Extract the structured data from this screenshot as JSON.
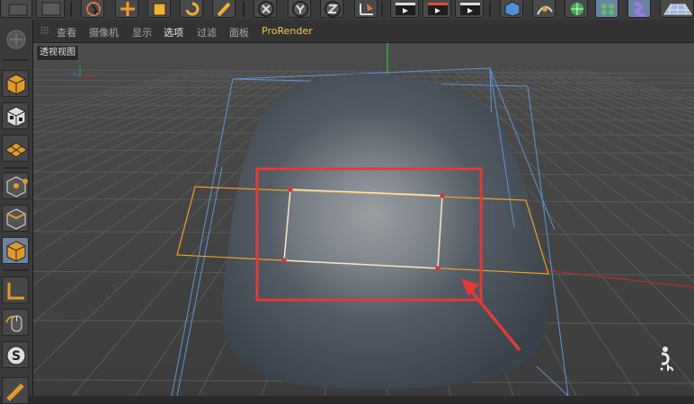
{
  "viewport_menu": {
    "items": [
      "查看",
      "摄像机",
      "显示",
      "选项",
      "过滤",
      "面板",
      "ProRender"
    ],
    "selected": "选项"
  },
  "viewport": {
    "label": "透视视图"
  },
  "colors": {
    "background": "#2b2b2b",
    "toolbar": "#3a3a3a",
    "viewport_sky": "#4b4b4b",
    "grid_line": "#5a5a5a",
    "object_body": "#4b535c",
    "bbox_line": "#5b95d8",
    "polygon_outline": "#f0a020",
    "selection_edge": "#f5e6c8",
    "selection_point": "#e03040",
    "annotation_red": "#e23a3a",
    "menu_text": "#a9a9a9",
    "prorender_text": "#f2c94c",
    "x_axis": "#c03030"
  },
  "toolbar_icons": [
    "render-region-icon",
    "select-icon",
    "move-icon",
    "scale-icon",
    "rotate-icon",
    "brush-icon",
    "x-axis-lock-icon",
    "y-axis-lock-icon",
    "z-axis-lock-icon",
    "world-coordinate-icon",
    "render-view-icon",
    "render-picture-viewer-icon",
    "render-settings-icon",
    "cube-object-icon",
    "pen-spline-icon",
    "subdivision-icon",
    "array-icon",
    "deformer-icon",
    "floor-icon"
  ],
  "palette_icons": [
    "make-editable-icon",
    "model-mode-icon",
    "texture-mode-icon",
    "workplane-icon",
    "points-mode-icon",
    "edges-mode-icon",
    "polygons-mode-icon",
    "axis-mode-icon",
    "tweak-mode-icon",
    "snap-icon",
    "dynamics-icon"
  ]
}
